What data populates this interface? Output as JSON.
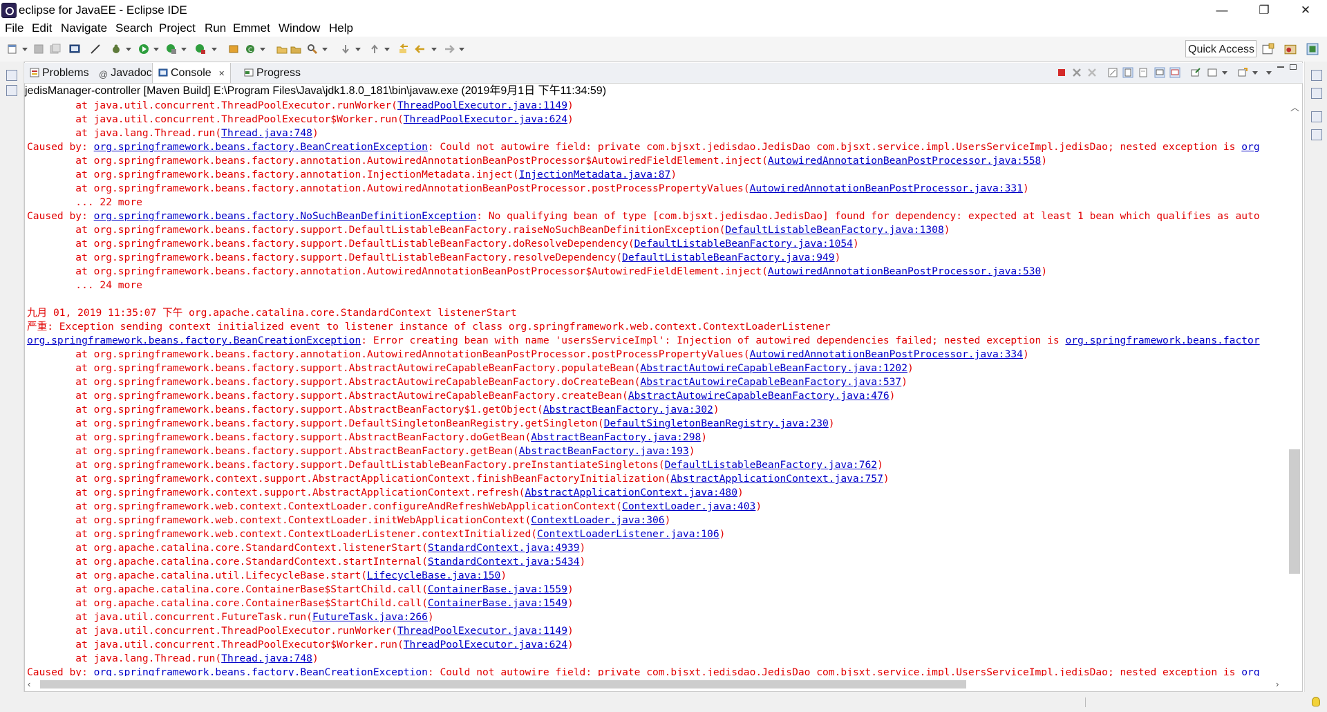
{
  "window": {
    "title": "eclipse for JavaEE - Eclipse IDE",
    "minimize": "—",
    "restore": "❐",
    "close": "✕"
  },
  "menu": [
    "File",
    "Edit",
    "Navigate",
    "Search",
    "Project",
    "Run",
    "Emmet",
    "Window",
    "Help"
  ],
  "toolbar": {
    "quick_access": "Quick Access"
  },
  "tabs": [
    {
      "label": "Problems",
      "icon": "problems-icon"
    },
    {
      "label": "Javadoc",
      "icon": "at-sign-icon"
    },
    {
      "label": "Console",
      "icon": "console-icon",
      "close": "✕"
    },
    {
      "label": "Progress",
      "icon": "progress-icon"
    }
  ],
  "console": {
    "launch": "jedisManager-controller [Maven Build] E:\\Program Files\\Java\\jdk1.8.0_181\\bin\\javaw.exe (2019年9月1日 下午11:34:59)",
    "lines": [
      [
        {
          "t": "\tat java.util.concurrent.ThreadPoolExecutor.runWorker("
        },
        {
          "t": "ThreadPoolExecutor.java:1149",
          "l": 1
        },
        {
          "t": ")"
        }
      ],
      [
        {
          "t": "\tat java.util.concurrent.ThreadPoolExecutor$Worker.run("
        },
        {
          "t": "ThreadPoolExecutor.java:624",
          "l": 1
        },
        {
          "t": ")"
        }
      ],
      [
        {
          "t": "\tat java.lang.Thread.run("
        },
        {
          "t": "Thread.java:748",
          "l": 1
        },
        {
          "t": ")"
        }
      ],
      [
        {
          "t": "Caused by: "
        },
        {
          "t": "org.springframework.beans.factory.BeanCreationException",
          "l": 1
        },
        {
          "t": ": Could not autowire field: private com.bjsxt.jedisdao.JedisDao com.bjsxt.service.impl.UsersServiceImpl.jedisDao; nested exception is "
        },
        {
          "t": "org",
          "l": 1
        }
      ],
      [
        {
          "t": "\tat org.springframework.beans.factory.annotation.AutowiredAnnotationBeanPostProcessor$AutowiredFieldElement.inject("
        },
        {
          "t": "AutowiredAnnotationBeanPostProcessor.java:558",
          "l": 1
        },
        {
          "t": ")"
        }
      ],
      [
        {
          "t": "\tat org.springframework.beans.factory.annotation.InjectionMetadata.inject("
        },
        {
          "t": "InjectionMetadata.java:87",
          "l": 1
        },
        {
          "t": ")"
        }
      ],
      [
        {
          "t": "\tat org.springframework.beans.factory.annotation.AutowiredAnnotationBeanPostProcessor.postProcessPropertyValues("
        },
        {
          "t": "AutowiredAnnotationBeanPostProcessor.java:331",
          "l": 1
        },
        {
          "t": ")"
        }
      ],
      [
        {
          "t": "\t... 22 more"
        }
      ],
      [
        {
          "t": "Caused by: "
        },
        {
          "t": "org.springframework.beans.factory.NoSuchBeanDefinitionException",
          "l": 1
        },
        {
          "t": ": No qualifying bean of type [com.bjsxt.jedisdao.JedisDao] found for dependency: expected at least 1 bean which qualifies as auto"
        }
      ],
      [
        {
          "t": "\tat org.springframework.beans.factory.support.DefaultListableBeanFactory.raiseNoSuchBeanDefinitionException("
        },
        {
          "t": "DefaultListableBeanFactory.java:1308",
          "l": 1
        },
        {
          "t": ")"
        }
      ],
      [
        {
          "t": "\tat org.springframework.beans.factory.support.DefaultListableBeanFactory.doResolveDependency("
        },
        {
          "t": "DefaultListableBeanFactory.java:1054",
          "l": 1
        },
        {
          "t": ")"
        }
      ],
      [
        {
          "t": "\tat org.springframework.beans.factory.support.DefaultListableBeanFactory.resolveDependency("
        },
        {
          "t": "DefaultListableBeanFactory.java:949",
          "l": 1
        },
        {
          "t": ")"
        }
      ],
      [
        {
          "t": "\tat org.springframework.beans.factory.annotation.AutowiredAnnotationBeanPostProcessor$AutowiredFieldElement.inject("
        },
        {
          "t": "AutowiredAnnotationBeanPostProcessor.java:530",
          "l": 1
        },
        {
          "t": ")"
        }
      ],
      [
        {
          "t": "\t... 24 more"
        }
      ],
      [
        {
          "t": ""
        }
      ],
      [
        {
          "t": "九月 01, 2019 11:35:07 下午 org.apache.catalina.core.StandardContext listenerStart"
        }
      ],
      [
        {
          "t": "严重: Exception sending context initialized event to listener instance of class org.springframework.web.context.ContextLoaderListener"
        }
      ],
      [
        {
          "t": "org.springframework.beans.factory.BeanCreationException",
          "l": 1
        },
        {
          "t": ": Error creating bean with name 'usersServiceImpl': Injection of autowired dependencies failed; nested exception is "
        },
        {
          "t": "org.springframework.beans.factor",
          "l": 1
        }
      ],
      [
        {
          "t": "\tat org.springframework.beans.factory.annotation.AutowiredAnnotationBeanPostProcessor.postProcessPropertyValues("
        },
        {
          "t": "AutowiredAnnotationBeanPostProcessor.java:334",
          "l": 1
        },
        {
          "t": ")"
        }
      ],
      [
        {
          "t": "\tat org.springframework.beans.factory.support.AbstractAutowireCapableBeanFactory.populateBean("
        },
        {
          "t": "AbstractAutowireCapableBeanFactory.java:1202",
          "l": 1
        },
        {
          "t": ")"
        }
      ],
      [
        {
          "t": "\tat org.springframework.beans.factory.support.AbstractAutowireCapableBeanFactory.doCreateBean("
        },
        {
          "t": "AbstractAutowireCapableBeanFactory.java:537",
          "l": 1
        },
        {
          "t": ")"
        }
      ],
      [
        {
          "t": "\tat org.springframework.beans.factory.support.AbstractAutowireCapableBeanFactory.createBean("
        },
        {
          "t": "AbstractAutowireCapableBeanFactory.java:476",
          "l": 1
        },
        {
          "t": ")"
        }
      ],
      [
        {
          "t": "\tat org.springframework.beans.factory.support.AbstractBeanFactory$1.getObject("
        },
        {
          "t": "AbstractBeanFactory.java:302",
          "l": 1
        },
        {
          "t": ")"
        }
      ],
      [
        {
          "t": "\tat org.springframework.beans.factory.support.DefaultSingletonBeanRegistry.getSingleton("
        },
        {
          "t": "DefaultSingletonBeanRegistry.java:230",
          "l": 1
        },
        {
          "t": ")"
        }
      ],
      [
        {
          "t": "\tat org.springframework.beans.factory.support.AbstractBeanFactory.doGetBean("
        },
        {
          "t": "AbstractBeanFactory.java:298",
          "l": 1
        },
        {
          "t": ")"
        }
      ],
      [
        {
          "t": "\tat org.springframework.beans.factory.support.AbstractBeanFactory.getBean("
        },
        {
          "t": "AbstractBeanFactory.java:193",
          "l": 1
        },
        {
          "t": ")"
        }
      ],
      [
        {
          "t": "\tat org.springframework.beans.factory.support.DefaultListableBeanFactory.preInstantiateSingletons("
        },
        {
          "t": "DefaultListableBeanFactory.java:762",
          "l": 1
        },
        {
          "t": ")"
        }
      ],
      [
        {
          "t": "\tat org.springframework.context.support.AbstractApplicationContext.finishBeanFactoryInitialization("
        },
        {
          "t": "AbstractApplicationContext.java:757",
          "l": 1
        },
        {
          "t": ")"
        }
      ],
      [
        {
          "t": "\tat org.springframework.context.support.AbstractApplicationContext.refresh("
        },
        {
          "t": "AbstractApplicationContext.java:480",
          "l": 1
        },
        {
          "t": ")"
        }
      ],
      [
        {
          "t": "\tat org.springframework.web.context.ContextLoader.configureAndRefreshWebApplicationContext("
        },
        {
          "t": "ContextLoader.java:403",
          "l": 1
        },
        {
          "t": ")"
        }
      ],
      [
        {
          "t": "\tat org.springframework.web.context.ContextLoader.initWebApplicationContext("
        },
        {
          "t": "ContextLoader.java:306",
          "l": 1
        },
        {
          "t": ")"
        }
      ],
      [
        {
          "t": "\tat org.springframework.web.context.ContextLoaderListener.contextInitialized("
        },
        {
          "t": "ContextLoaderListener.java:106",
          "l": 1
        },
        {
          "t": ")"
        }
      ],
      [
        {
          "t": "\tat org.apache.catalina.core.StandardContext.listenerStart("
        },
        {
          "t": "StandardContext.java:4939",
          "l": 1
        },
        {
          "t": ")"
        }
      ],
      [
        {
          "t": "\tat org.apache.catalina.core.StandardContext.startInternal("
        },
        {
          "t": "StandardContext.java:5434",
          "l": 1
        },
        {
          "t": ")"
        }
      ],
      [
        {
          "t": "\tat org.apache.catalina.util.LifecycleBase.start("
        },
        {
          "t": "LifecycleBase.java:150",
          "l": 1
        },
        {
          "t": ")"
        }
      ],
      [
        {
          "t": "\tat org.apache.catalina.core.ContainerBase$StartChild.call("
        },
        {
          "t": "ContainerBase.java:1559",
          "l": 1
        },
        {
          "t": ")"
        }
      ],
      [
        {
          "t": "\tat org.apache.catalina.core.ContainerBase$StartChild.call("
        },
        {
          "t": "ContainerBase.java:1549",
          "l": 1
        },
        {
          "t": ")"
        }
      ],
      [
        {
          "t": "\tat java.util.concurrent.FutureTask.run("
        },
        {
          "t": "FutureTask.java:266",
          "l": 1
        },
        {
          "t": ")"
        }
      ],
      [
        {
          "t": "\tat java.util.concurrent.ThreadPoolExecutor.runWorker("
        },
        {
          "t": "ThreadPoolExecutor.java:1149",
          "l": 1
        },
        {
          "t": ")"
        }
      ],
      [
        {
          "t": "\tat java.util.concurrent.ThreadPoolExecutor$Worker.run("
        },
        {
          "t": "ThreadPoolExecutor.java:624",
          "l": 1
        },
        {
          "t": ")"
        }
      ],
      [
        {
          "t": "\tat java.lang.Thread.run("
        },
        {
          "t": "Thread.java:748",
          "l": 1
        },
        {
          "t": ")"
        }
      ],
      [
        {
          "t": "Caused by: "
        },
        {
          "t": "org.springframework.beans.factory.BeanCreationException",
          "l": 1
        },
        {
          "t": ": Could not autowire field: private com.bjsxt.jedisdao.JedisDao com.bjsxt.service.impl.UsersServiceImpl.jedisDao; nested exception is "
        },
        {
          "t": "org",
          "l": 1
        }
      ]
    ]
  },
  "colors": {
    "error_text": "#e10000",
    "link": "#0000c8",
    "background": "#ffffff"
  }
}
